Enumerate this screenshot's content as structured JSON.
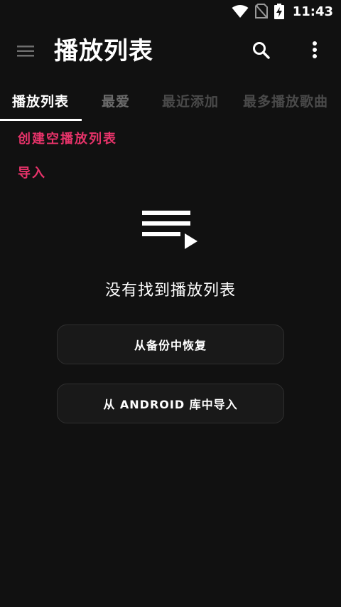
{
  "status_bar": {
    "time": "11:43",
    "icons": [
      "wifi-icon",
      "no-sim-icon",
      "battery-charging-icon"
    ]
  },
  "app_bar": {
    "title": "播放列表",
    "icons": [
      "menu-icon",
      "search-icon",
      "more-vert-icon"
    ]
  },
  "tabs": [
    {
      "label": "播放列表",
      "active": true
    },
    {
      "label": "最爱",
      "active": false
    },
    {
      "label": "最近添加",
      "active": false
    },
    {
      "label": "最多播放歌曲",
      "active": false
    }
  ],
  "actions": {
    "create_empty": "创建空播放列表",
    "import": "导入"
  },
  "empty_state": {
    "icon": "playlist-play-icon",
    "message": "没有找到播放列表"
  },
  "buttons": {
    "restore_backup": "从备份中恢复",
    "import_android": "从 ANDROID 库中导入"
  },
  "colors": {
    "background": "#111111",
    "accent": "#e8336a",
    "text": "#ffffff"
  }
}
